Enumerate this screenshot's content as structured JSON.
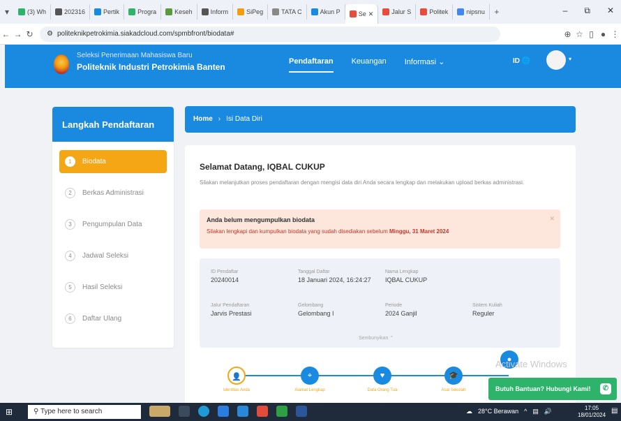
{
  "browser": {
    "tabs": [
      {
        "label": "(3) Wh",
        "color": "#2eb36b"
      },
      {
        "label": "202316",
        "color": "#555555"
      },
      {
        "label": "Pertik",
        "color": "#1a8ae0"
      },
      {
        "label": "Progra",
        "color": "#2eb36b"
      },
      {
        "label": "Keseh",
        "color": "#5a9a3a"
      },
      {
        "label": "Inform",
        "color": "#555555"
      },
      {
        "label": "SiPeg",
        "color": "#f39c12"
      },
      {
        "label": "TATA C",
        "color": "#888888"
      },
      {
        "label": "Akun P",
        "color": "#1a8ae0"
      },
      {
        "label": "Se",
        "color": "#e74c3c",
        "active": true
      },
      {
        "label": "Jalur S",
        "color": "#e74c3c"
      },
      {
        "label": "Politek",
        "color": "#e74c3c"
      },
      {
        "label": "nipsnu",
        "color": "#4285f4"
      }
    ],
    "url": "politeknikpetrokimia.siakadcloud.com/spmbfront/biodata#"
  },
  "header": {
    "subtitle": "Seleksi Penerimaan Mahasiswa Baru",
    "title": "Politeknik Industri Petrokimia Banten",
    "nav": [
      "Pendaftaran",
      "Keuangan",
      "Informasi"
    ],
    "active_nav": "Pendaftaran",
    "lang": "ID"
  },
  "sidebar": {
    "title": "Langkah Pendaftaran",
    "items": [
      {
        "num": "1",
        "label": "Biodata"
      },
      {
        "num": "2",
        "label": "Berkas Administrasi"
      },
      {
        "num": "3",
        "label": "Pengumpulan Data"
      },
      {
        "num": "4",
        "label": "Jadwal Seleksi"
      },
      {
        "num": "5",
        "label": "Hasil Seleksi"
      },
      {
        "num": "6",
        "label": "Daftar Ulang"
      }
    ]
  },
  "breadcrumb": {
    "home": "Home",
    "current": "Isi Data Diri"
  },
  "main": {
    "welcome": "Selamat Datang, IQBAL CUKUP",
    "intro": "Silakan melanjutkan proses pendaftaran dengan mengisi data diri Anda secara lengkap dan melakukan upload berkas administrasi.",
    "alert": {
      "title": "Anda belum mengumpulkan biodata",
      "text": "Silakan lengkapi dan kumpulkan biodata yang sudah disediakan sebelum",
      "deadline": "Minggu, 31 Maret 2024"
    },
    "info": {
      "id_label": "ID Pendaftar",
      "id_value": "20240014",
      "date_label": "Tanggal Daftar",
      "date_value": "18 Januari 2024, 16:24:27",
      "name_label": "Nama Lengkap",
      "name_value": "IQBAL CUKUP",
      "path_label": "Jalur Pendaftaran",
      "path_value": "Jarvis Prestasi",
      "wave_label": "Gelombang",
      "wave_value": "Gelombang I",
      "period_label": "Periode",
      "period_value": "2024 Ganjil",
      "system_label": "Sistem Kuliah",
      "system_value": "Reguler",
      "more": "Sembunyikan"
    },
    "steps": [
      "Identitas Anda",
      "Alamat Lengkap",
      "Data Orang Tua",
      "Asal Sekolah"
    ]
  },
  "watermark": "Activate Windows",
  "help": "Butuh Bantuan? Hubungi Kami!",
  "taskbar": {
    "search": "Type here to search",
    "weather": "28°C Berawan",
    "time": "17:05",
    "date": "18/01/2024"
  }
}
